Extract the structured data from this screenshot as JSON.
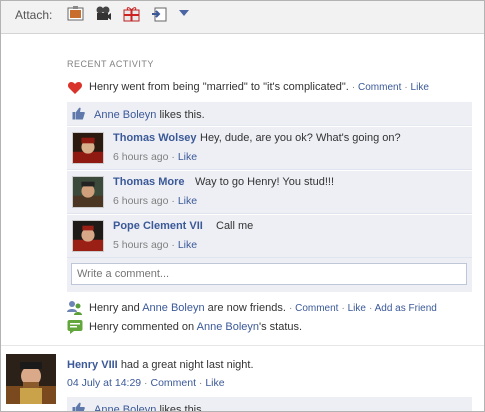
{
  "attach_bar": {
    "label": "Attach:",
    "icons": [
      "photo-icon",
      "video-icon",
      "gift-icon",
      "share-link-icon",
      "chevron-down-icon"
    ]
  },
  "recent_activity": {
    "title": "RECENT ACTIVITY",
    "status_story": {
      "icon": "heart-icon",
      "text": "Henry went from being \"married\" to \"it's complicated\".",
      "actions": [
        "Comment",
        "Like"
      ]
    },
    "likes": {
      "icon": "thumbs-up-icon",
      "name": "Anne Boleyn",
      "suffix": " likes this."
    },
    "comments": [
      {
        "name": "Thomas Wolsey",
        "text": "Hey, dude, are you ok? What's going on?",
        "time": "6 hours ago",
        "action": "Like",
        "avatar_color": "#8e1a12"
      },
      {
        "name": "Thomas More",
        "text": "Way to go Henry! You stud!!!",
        "time": "6 hours ago",
        "action": "Like",
        "avatar_color": "#4a3622"
      },
      {
        "name": "Pope Clement VII",
        "text": "Call me",
        "time": "5 hours ago",
        "action": "Like",
        "avatar_color": "#9a2016"
      }
    ],
    "comment_input_placeholder": "Write a comment...",
    "friend_story": {
      "icon": "friends-icon",
      "prefix": "Henry and ",
      "name": "Anne Boleyn",
      "suffix": " are now friends.",
      "actions": [
        "Comment",
        "Like",
        "Add as Friend"
      ]
    },
    "comment_story": {
      "icon": "comment-bubble-icon",
      "prefix": "Henry commented on ",
      "name": "Anne Boleyn",
      "suffix": "'s status."
    }
  },
  "post": {
    "author": "Henry VIII",
    "text": "had a great night last night.",
    "time": "04 July at 14:29",
    "actions": [
      "Comment",
      "Like"
    ],
    "likes_name": "Anne Boleyn",
    "likes_suffix": " likes this."
  }
}
